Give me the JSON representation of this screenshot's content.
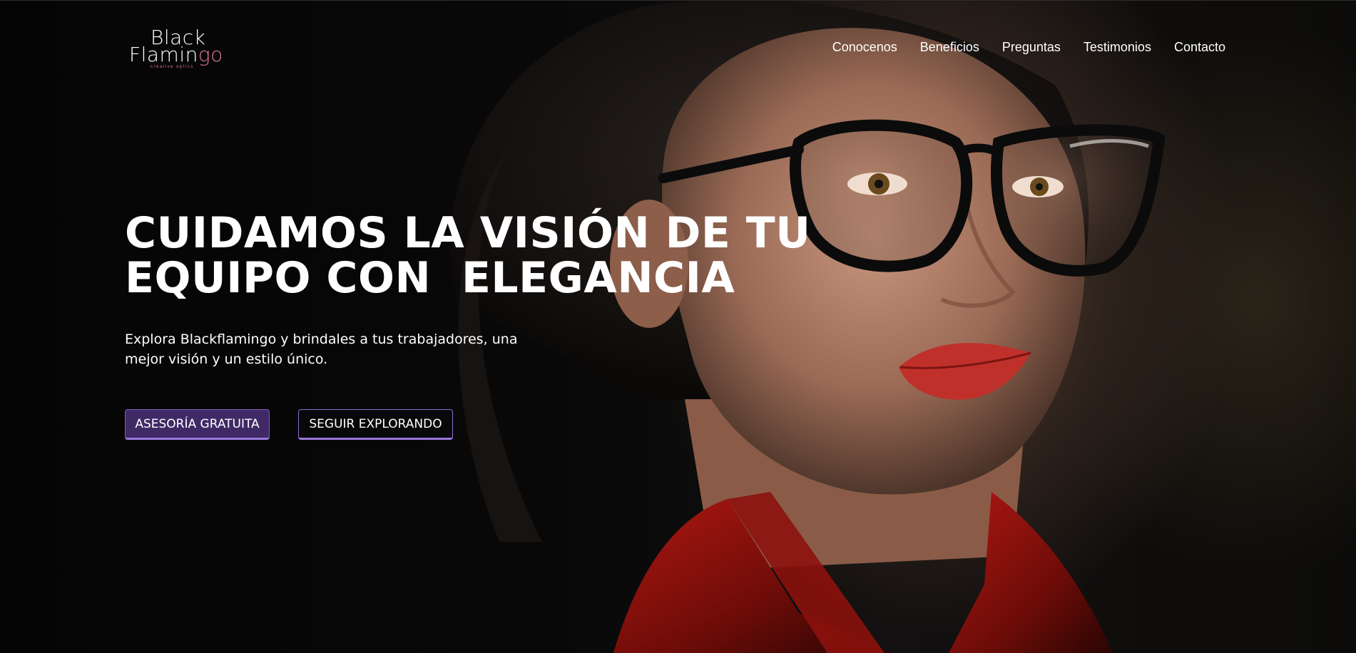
{
  "brand": {
    "logo_line1": "Black",
    "logo_line2_main": "Flamin",
    "logo_line2_accent": "go",
    "logo_tagline": "creative optics",
    "accent_color": "#e0749b"
  },
  "nav": {
    "items": [
      {
        "label": "Conocenos"
      },
      {
        "label": "Beneficios"
      },
      {
        "label": "Preguntas"
      },
      {
        "label": "Testimonios"
      },
      {
        "label": "Contacto"
      }
    ]
  },
  "hero": {
    "headline_line1": "CUIDAMOS LA VISIÓN DE TU",
    "headline_line2": "EQUIPO CON  ELEGANCIA",
    "subtitle": "Explora Blackflamingo y brindales a tus trabajadores, una mejor visión y un estilo único.",
    "primary_cta": "ASESORÍA GRATUITA",
    "secondary_cta": "SEGUIR EXPLORANDO",
    "image_subject": "woman-with-black-cat-eye-glasses-red-shirt",
    "button_color": "#3f2a66",
    "button_border_color": "#9a78dd"
  }
}
